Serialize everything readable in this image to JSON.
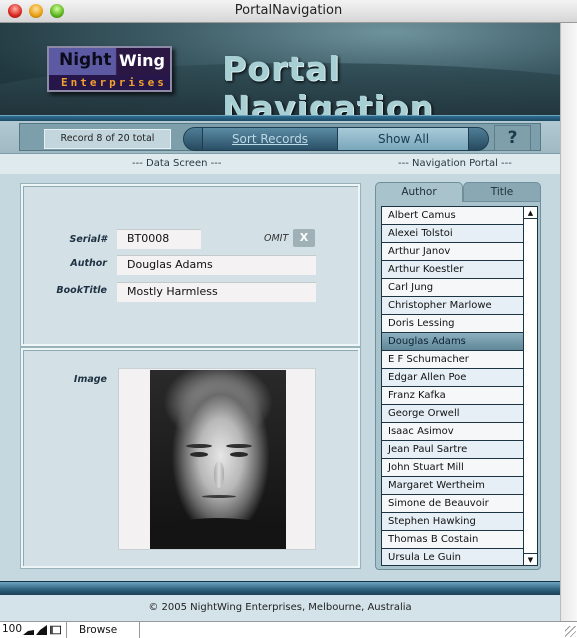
{
  "window": {
    "title": "PortalNavigation"
  },
  "banner": {
    "logo_word1": "Night",
    "logo_word2": "Wing",
    "logo_sub": "Enterprises",
    "title": "Portal Navigation"
  },
  "toolbar": {
    "record_status": "Record 8 of 20 total",
    "sort_label": "Sort Records",
    "show_all_label": "Show All",
    "help_label": "?"
  },
  "sections": {
    "data_screen": "--- Data Screen ---",
    "navigation_portal": "--- Navigation Portal ---"
  },
  "form": {
    "serial_label": "Serial#",
    "serial_value": "BT0008",
    "author_label": "Author",
    "author_value": "Douglas Adams",
    "title_label": "BookTitle",
    "title_value": "Mostly Harmless",
    "omit_label": "OMIT",
    "omit_button": "X",
    "image_label": "Image"
  },
  "portal": {
    "tabs": [
      {
        "label": "Author",
        "active": true
      },
      {
        "label": "Title",
        "active": false
      }
    ],
    "selected": "Douglas Adams",
    "items": [
      "Albert Camus",
      "Alexei Tolstoi",
      "Arthur Janov",
      "Arthur Koestler",
      "Carl Jung",
      "Christopher Marlowe",
      "Doris Lessing",
      "Douglas Adams",
      "E F Schumacher",
      "Edgar Allen Poe",
      "Franz Kafka",
      "George Orwell",
      "Isaac Asimov",
      "Jean Paul Sartre",
      "John Stuart Mill",
      "Margaret Wertheim",
      "Simone de Beauvoir",
      "Stephen Hawking",
      "Thomas B Costain",
      "Ursula Le Guin"
    ]
  },
  "footer": {
    "copyright": "© 2005 NightWing Enterprises, Melbourne, Australia"
  },
  "statusbar": {
    "zoom": "100",
    "mode": "Browse"
  }
}
